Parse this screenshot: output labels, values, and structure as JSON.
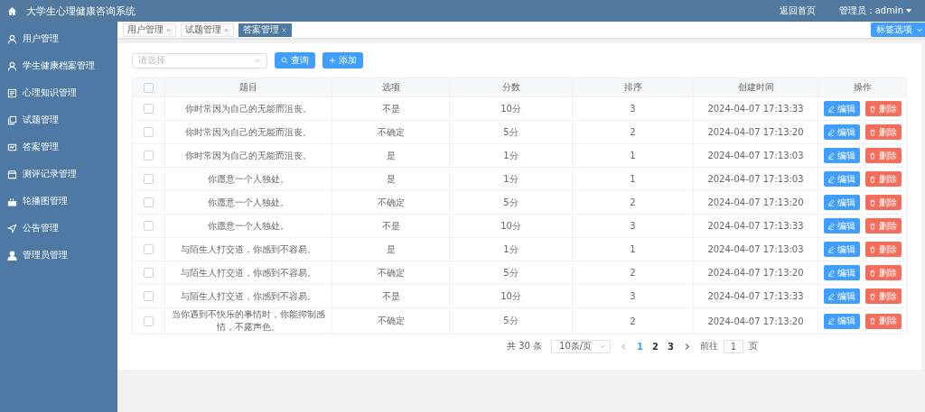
{
  "header": {
    "title": "大学生心理健康咨询系统",
    "home_link": "返回首页",
    "user": "管理员：admin"
  },
  "sidebar": {
    "items": [
      {
        "label": "用户管理"
      },
      {
        "label": "学生健康档案管理"
      },
      {
        "label": "心理知识管理"
      },
      {
        "label": "试题管理"
      },
      {
        "label": "答案管理"
      },
      {
        "label": "测评记录管理"
      },
      {
        "label": "轮播图管理"
      },
      {
        "label": "公告管理"
      },
      {
        "label": "管理员管理"
      }
    ]
  },
  "tabs": [
    {
      "label": "用户管理",
      "selected": false
    },
    {
      "label": "试题管理",
      "selected": false
    },
    {
      "label": "答案管理",
      "selected": true
    }
  ],
  "tab_options": "标签选项",
  "toolbar": {
    "select_placeholder": "请选择",
    "search": "查询",
    "add": "添加"
  },
  "table": {
    "all_checked": false,
    "columns": [
      "题目",
      "选项",
      "分数",
      "排序",
      "创建时间",
      "操作"
    ],
    "rows": [
      {
        "checked": false,
        "cells": [
          "你时常因为自己的无能而沮丧。",
          "不是",
          "10分",
          "3",
          "2024-04-07 17:13:33"
        ],
        "edit": "编辑",
        "delete": "删除"
      },
      {
        "checked": false,
        "cells": [
          "你时常因为自己的无能而沮丧。",
          "不确定",
          "5分",
          "2",
          "2024-04-07 17:13:20"
        ],
        "edit": "编辑",
        "delete": "删除"
      },
      {
        "checked": false,
        "cells": [
          "你时常因为自己的无能而沮丧。",
          "是",
          "1分",
          "1",
          "2024-04-07 17:13:03"
        ],
        "edit": "编辑",
        "delete": "删除"
      },
      {
        "checked": false,
        "cells": [
          "你愿意一个人独处。",
          "是",
          "1分",
          "1",
          "2024-04-07 17:13:03"
        ],
        "edit": "编辑",
        "delete": "删除"
      },
      {
        "checked": false,
        "cells": [
          "你愿意一个人独处。",
          "不确定",
          "5分",
          "2",
          "2024-04-07 17:13:20"
        ],
        "edit": "编辑",
        "delete": "删除"
      },
      {
        "checked": false,
        "cells": [
          "你愿意一个人独处。",
          "不是",
          "10分",
          "3",
          "2024-04-07 17:13:33"
        ],
        "edit": "编辑",
        "delete": "删除"
      },
      {
        "checked": false,
        "cells": [
          "与陌生人打交道，你感到不容易。",
          "是",
          "1分",
          "1",
          "2024-04-07 17:13:03"
        ],
        "edit": "编辑",
        "delete": "删除"
      },
      {
        "checked": false,
        "cells": [
          "与陌生人打交道，你感到不容易。",
          "不确定",
          "5分",
          "2",
          "2024-04-07 17:13:20"
        ],
        "edit": "编辑",
        "delete": "删除"
      },
      {
        "checked": false,
        "cells": [
          "与陌生人打交道，你感到不容易。",
          "不是",
          "10分",
          "3",
          "2024-04-07 17:13:33"
        ],
        "edit": "编辑",
        "delete": "删除"
      },
      {
        "checked": false,
        "cells": [
          "当你遇到不快乐的事情时，你能抑制感情，不露声色。",
          "不确定",
          "5分",
          "2",
          "2024-04-07 17:13:20"
        ],
        "edit": "编辑",
        "delete": "删除"
      }
    ]
  },
  "pagination": {
    "total": "共 30 条",
    "page_size": "10条/页",
    "pages": [
      {
        "label": "1",
        "selected": true
      },
      {
        "label": "2",
        "selected": false
      },
      {
        "label": "3",
        "selected": false
      }
    ],
    "goto_label": "前往",
    "goto_value": "1",
    "goto_suffix": "页"
  }
}
